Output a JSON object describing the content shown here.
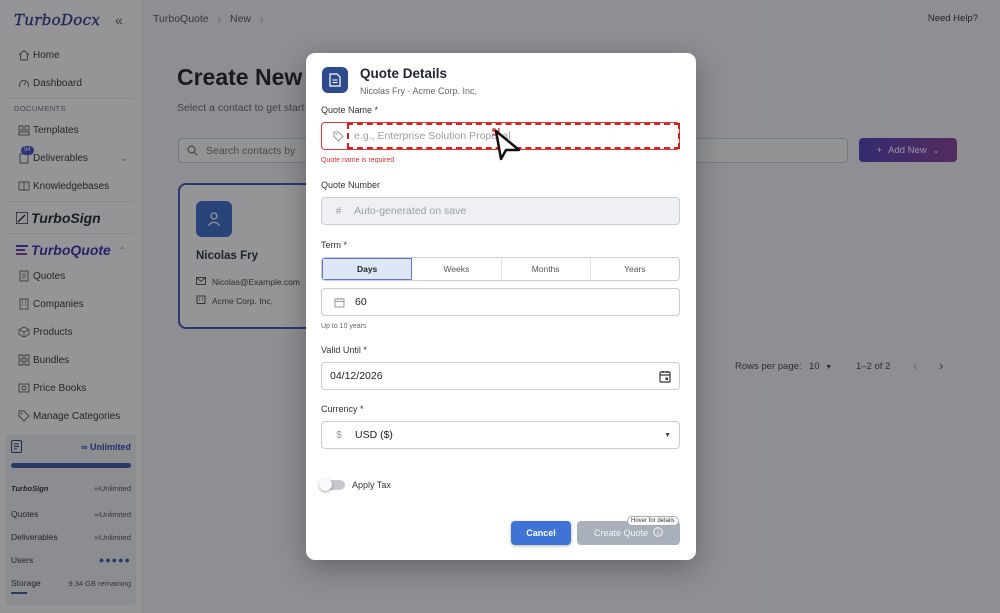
{
  "sidebar": {
    "logo": "TurboDocx",
    "items_top": [
      {
        "label": "Home",
        "icon": "home-icon"
      },
      {
        "label": "Dashboard",
        "icon": "dashboard-icon"
      }
    ],
    "section_documents": "DOCUMENTS",
    "doc_items": [
      {
        "label": "Templates",
        "icon": "templates-icon"
      },
      {
        "label": "Deliverables",
        "icon": "deliverables-icon",
        "badge": "94"
      },
      {
        "label": "Knowledgebases",
        "icon": "book-icon"
      }
    ],
    "turbosign": "TurboSign",
    "turboquote": "TurboQuote",
    "quote_items": [
      {
        "label": "Quotes"
      },
      {
        "label": "Companies"
      },
      {
        "label": "Products"
      },
      {
        "label": "Bundles"
      },
      {
        "label": "Price Books"
      },
      {
        "label": "Manage Categories"
      }
    ],
    "plan": {
      "label": "Unlimited",
      "rows": [
        {
          "label": "TurboSign",
          "value": "Unlimited"
        },
        {
          "label": "Quotes",
          "value": "Unlimited"
        },
        {
          "label": "Deliverables",
          "value": "Unlimited"
        },
        {
          "label": "Users",
          "value": "●●●●●"
        },
        {
          "label": "Storage",
          "value": "9.34 GB remaining"
        }
      ]
    }
  },
  "header": {
    "breadcrumb_1": "TurboQuote",
    "breadcrumb_2": "New",
    "help": "Need Help?"
  },
  "page": {
    "title": "Create New",
    "subtitle": "Select a contact to get start",
    "search_placeholder": "Search contacts by",
    "add_new": "Add New"
  },
  "contact": {
    "name": "Nicolas Fry",
    "email": "Nicolas@Example.com",
    "company": "Acme Corp. Inc,"
  },
  "pager": {
    "rows_label": "Rows per page:",
    "rows_value": "10",
    "range": "1–2 of 2"
  },
  "modal": {
    "title": "Quote Details",
    "subtitle": "Nicolas Fry · Acme Corp. Inc,",
    "quote_name_label": "Quote Name *",
    "quote_name_placeholder": "e.g., Enterprise Solution Proposal",
    "quote_name_error": "Quote name is required",
    "quote_number_label": "Quote Number",
    "quote_number_placeholder": "Auto-generated on save",
    "term_label": "Term *",
    "term_options": [
      "Days",
      "Weeks",
      "Months",
      "Years"
    ],
    "term_selected": "Days",
    "term_value": "60",
    "term_hint": "Up to 10 years",
    "valid_until_label": "Valid Until *",
    "valid_until_value": "04/12/2026",
    "currency_label": "Currency *",
    "currency_value": "USD ($)",
    "apply_tax_label": "Apply Tax",
    "cancel_label": "Cancel",
    "create_label": "Create Quote",
    "hover_hint": "Hover for details"
  }
}
